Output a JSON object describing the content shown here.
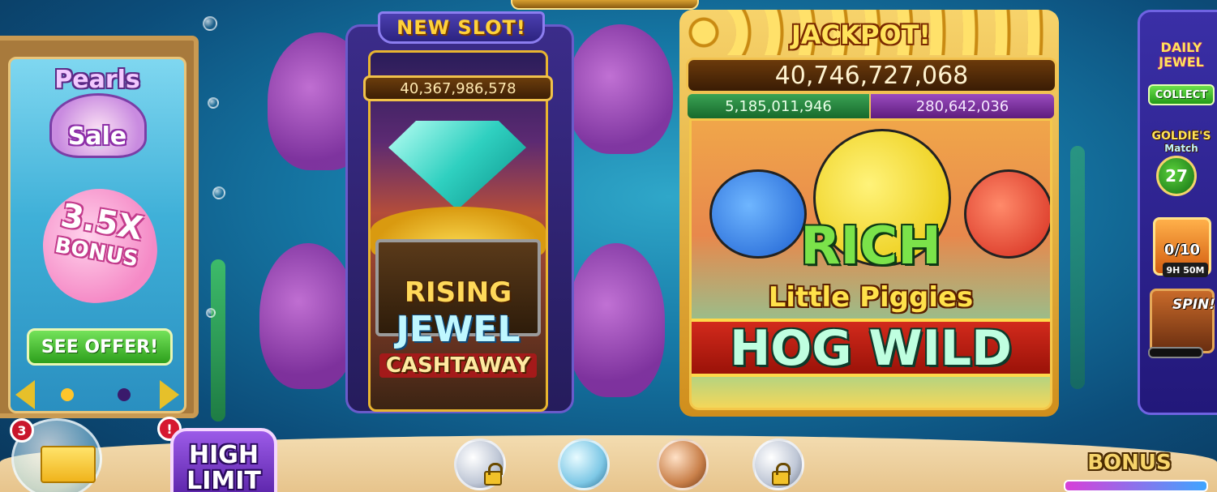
{
  "promo": {
    "title": "Pearls",
    "subtitle": "Sale",
    "bonus_value": "3.5X",
    "bonus_label": "BONUS",
    "cta": "SEE OFFER!"
  },
  "new_slot": {
    "banner": "NEW SLOT!",
    "jackpot": "40,367,986,578",
    "game_line1": "RISING",
    "game_line2": "JEWEL",
    "game_line3": "CASHTAWAY"
  },
  "jackpot": {
    "banner": "JACKPOT!",
    "main_value": "40,746,727,068",
    "green_value": "5,185,011,946",
    "purple_value": "280,642,036",
    "title_line1": "RICH",
    "title_line2": "Little Piggies",
    "title_line3": "HOG WILD"
  },
  "sidebar": {
    "daily_jewel_line1": "DAILY",
    "daily_jewel_line2": "JEWEL",
    "collect_label": "COLLECT",
    "goldies_title": "GOLDIE'S",
    "goldies_subtitle": "Match",
    "goldies_count": "27",
    "card_progress": "0/10",
    "card_timer": "9H 50M",
    "spin_label": "SPIN!"
  },
  "bottom": {
    "mail_count": "3",
    "alert_badge": "!",
    "high_limit_line1": "HIGH",
    "high_limit_line2": "LIMIT",
    "bonus_label": "BONUS"
  },
  "colors": {
    "ocean": "#1679a6",
    "gold": "#f2c24f",
    "green_jackpot": "#3aa354",
    "purple_jackpot": "#9a4bbf",
    "cta_green": "#2d9f1c"
  }
}
